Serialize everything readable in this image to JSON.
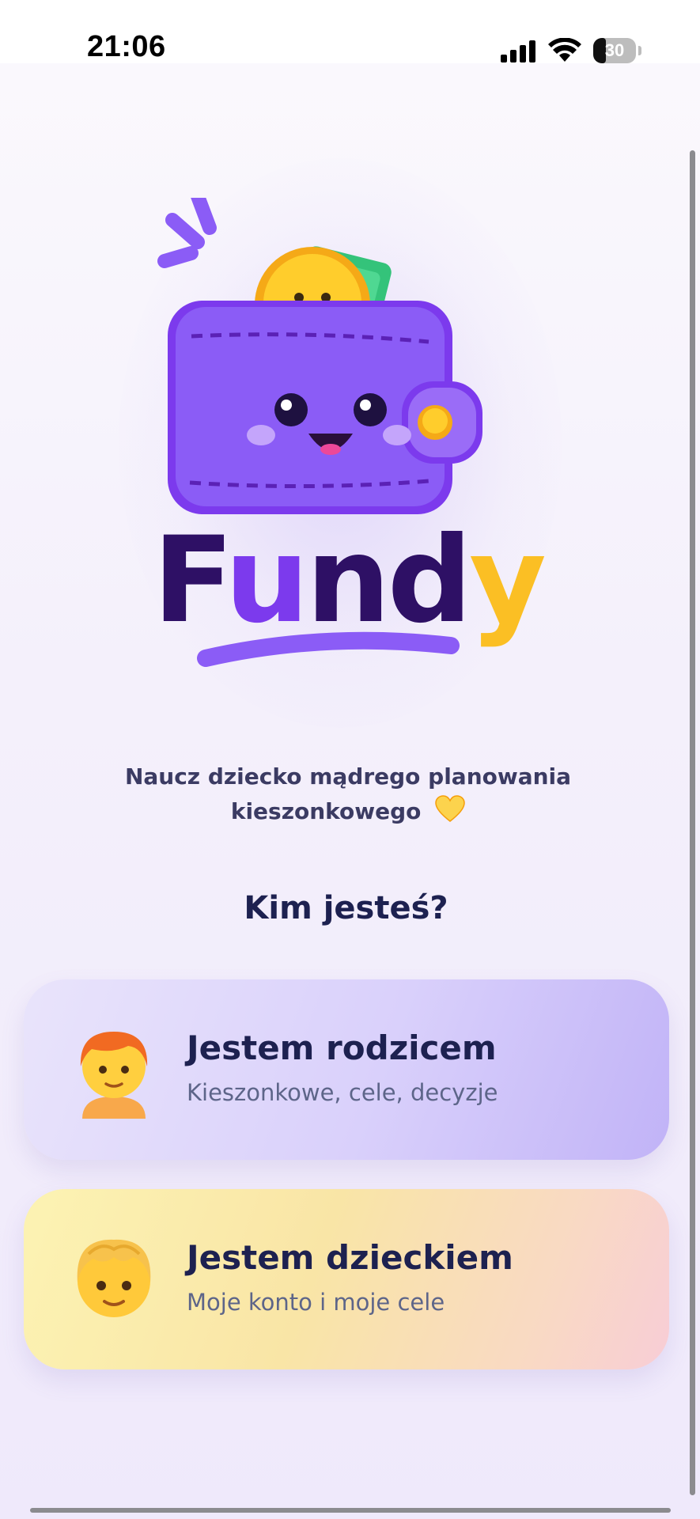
{
  "status_bar": {
    "time": "21:06",
    "battery_level": "30",
    "battery_fraction": 0.3
  },
  "logo": {
    "brand": "Fundy",
    "icon": "wallet-mascot-icon"
  },
  "tagline": {
    "text": "Naucz dziecko mądrego planowania kieszonkowego",
    "emoji": "yellow-heart-icon"
  },
  "question": "Kim jesteś?",
  "roles": [
    {
      "title": "Jestem rodzicem",
      "subtitle": "Kieszonkowe, cele, decyzje",
      "icon": "parent-avatar-icon"
    },
    {
      "title": "Jestem dzieckiem",
      "subtitle": "Moje konto i moje cele",
      "icon": "child-avatar-icon"
    }
  ],
  "colors": {
    "accent_purple": "#8b5cf6",
    "accent_yellow": "#fbbf24",
    "text_dark": "#1d2150"
  }
}
